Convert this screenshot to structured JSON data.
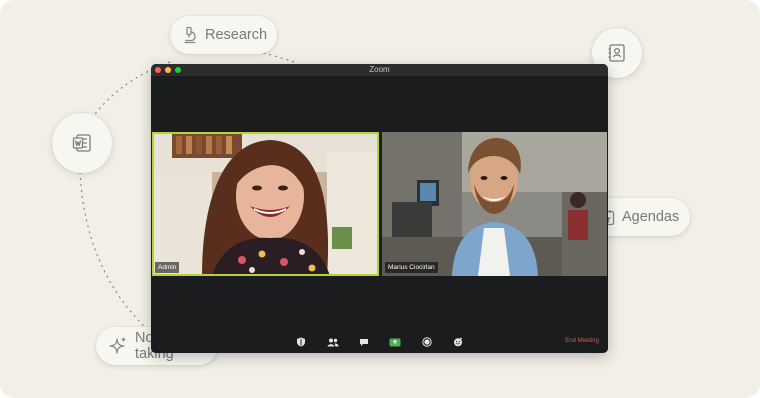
{
  "window": {
    "title": "Zoom"
  },
  "participants": [
    {
      "name": "Admin",
      "active_speaker": true
    },
    {
      "name": "Marius Ciocirlan",
      "active_speaker": false
    }
  ],
  "toolbar": {
    "icons": [
      "security-icon",
      "participants-icon",
      "chat-icon",
      "share-screen-icon",
      "record-icon",
      "reactions-icon"
    ],
    "end_label": "End Meeting"
  },
  "pills": {
    "research": "Research",
    "agendas": "Agendas",
    "note_taking": "Note taking"
  },
  "colors": {
    "background": "#f2f0e6",
    "active_speaker_border": "#b5d334",
    "end_meeting": "#e05a4c",
    "share_button": "#4caf50"
  }
}
